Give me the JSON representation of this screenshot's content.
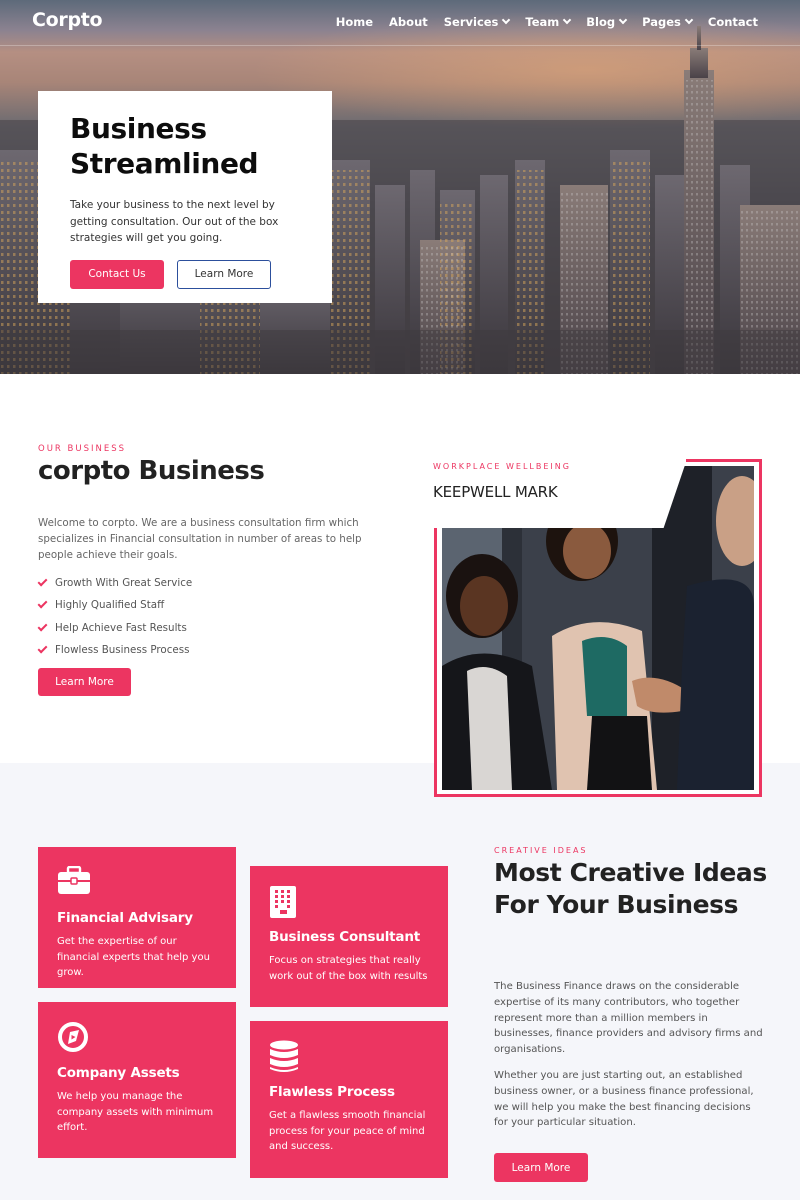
{
  "brand": {
    "logo": "Corpto",
    "accent": "#ec3561",
    "outline_accent": "#2c4f9c"
  },
  "nav": {
    "items": [
      {
        "label": "Home",
        "dropdown": false
      },
      {
        "label": "About",
        "dropdown": false
      },
      {
        "label": "Services",
        "dropdown": true
      },
      {
        "label": "Team",
        "dropdown": true
      },
      {
        "label": "Blog",
        "dropdown": true
      },
      {
        "label": "Pages",
        "dropdown": true
      },
      {
        "label": "Contact",
        "dropdown": false
      }
    ]
  },
  "hero": {
    "title_line1": "Business",
    "title_line2": "Streamlined",
    "text": "Take your business to the next level by getting consultation. Our out of the box strategies will get you going.",
    "primary_button": "Contact Us",
    "secondary_button": "Learn More",
    "image": "city-skyline-photo"
  },
  "about": {
    "eyebrow": "OUR BUSINESS",
    "title": "corpto Business",
    "text": "Welcome to corpto. We are a business consultation firm which specializes in Financial consultation in number of areas to help people achieve their goals.",
    "checklist": [
      "Growth With Great Service",
      "Highly Qualified Staff",
      "Help Achieve Fast Results",
      "Flowless Business Process"
    ],
    "button": "Learn More",
    "card": {
      "eyebrow": "WORKPLACE WELLBEING",
      "title": "KEEPWELL MARK"
    },
    "image": "handshake-team-photo"
  },
  "services": {
    "cards": [
      {
        "icon": "briefcase-icon",
        "title": "Financial Advisary",
        "text": "Get the expertise of our financial experts that help you grow."
      },
      {
        "icon": "building-icon",
        "title": "Business Consultant",
        "text": "Focus on strategies that really work out of the box with results"
      },
      {
        "icon": "compass-icon",
        "title": "Company Assets",
        "text": "We help you manage the company assets with minimum effort."
      },
      {
        "icon": "database-icon",
        "title": "Flawless Process",
        "text": "Get a flawless smooth financial process for your peace of mind and success."
      }
    ]
  },
  "ideas": {
    "eyebrow": "CREATIVE IDEAS",
    "title": "Most Creative Ideas For Your Business",
    "p1": "The Business Finance draws on the considerable expertise of its many contributors, who together represent more than a million members in businesses, finance providers and advisory firms and organisations.",
    "p2": "Whether you are just starting out, an established business owner, or a business finance professional, we will help you make the best financing decisions for your particular situation.",
    "button": "Learn More"
  }
}
